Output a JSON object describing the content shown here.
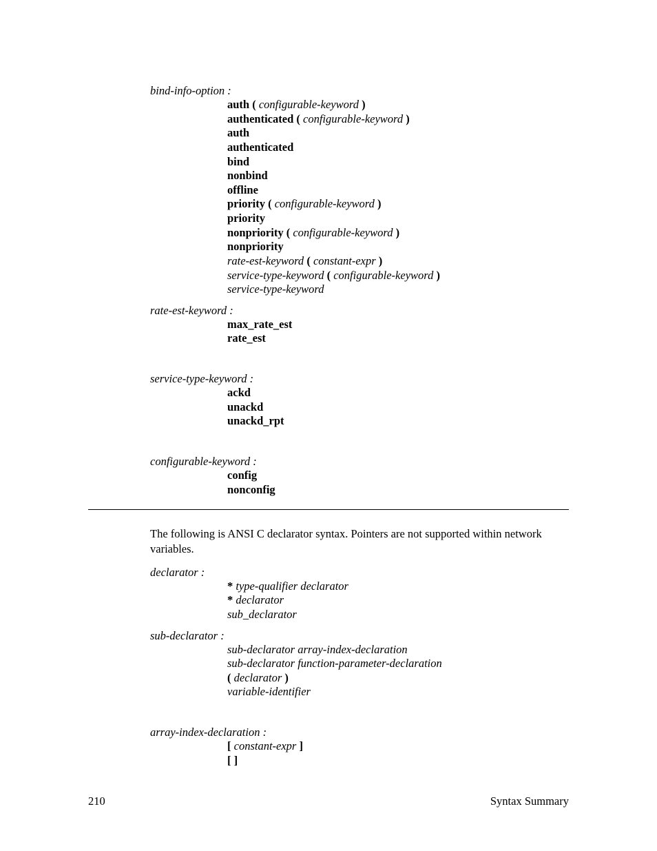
{
  "section1": {
    "head1": "bind-info-option :",
    "alts1": [
      [
        {
          "t": "kw",
          "v": "auth ("
        },
        {
          "t": "sp",
          "v": " "
        },
        {
          "t": "nt",
          "v": "configurable-keyword"
        },
        {
          "t": "sp",
          "v": " "
        },
        {
          "t": "kw",
          "v": ")"
        }
      ],
      [
        {
          "t": "kw",
          "v": "authenticated ("
        },
        {
          "t": "sp",
          "v": " "
        },
        {
          "t": "nt",
          "v": "configurable-keyword"
        },
        {
          "t": "sp",
          "v": " "
        },
        {
          "t": "kw",
          "v": ")"
        }
      ],
      [
        {
          "t": "kw",
          "v": "auth"
        }
      ],
      [
        {
          "t": "kw",
          "v": "authenticated"
        }
      ],
      [
        {
          "t": "kw",
          "v": "bind"
        }
      ],
      [
        {
          "t": "kw",
          "v": "nonbind"
        }
      ],
      [
        {
          "t": "kw",
          "v": "offline"
        }
      ],
      [
        {
          "t": "kw",
          "v": "priority ("
        },
        {
          "t": "sp",
          "v": " "
        },
        {
          "t": "nt",
          "v": "configurable-keyword"
        },
        {
          "t": "sp",
          "v": " "
        },
        {
          "t": "kw",
          "v": ")"
        }
      ],
      [
        {
          "t": "kw",
          "v": "priority"
        }
      ],
      [
        {
          "t": "kw",
          "v": "nonpriority ("
        },
        {
          "t": "sp",
          "v": " "
        },
        {
          "t": "nt",
          "v": "configurable-keyword"
        },
        {
          "t": "sp",
          "v": " "
        },
        {
          "t": "kw",
          "v": ")"
        }
      ],
      [
        {
          "t": "kw",
          "v": "nonpriority"
        }
      ],
      [
        {
          "t": "nt",
          "v": "rate-est-keyword"
        },
        {
          "t": "sp",
          "v": " "
        },
        {
          "t": "kw",
          "v": "("
        },
        {
          "t": "sp",
          "v": " "
        },
        {
          "t": "nt",
          "v": "constant-expr"
        },
        {
          "t": "sp",
          "v": " "
        },
        {
          "t": "kw",
          "v": ")"
        }
      ],
      [
        {
          "t": "nt",
          "v": "service-type-keyword"
        },
        {
          "t": "sp",
          "v": " "
        },
        {
          "t": "kw",
          "v": "("
        },
        {
          "t": "sp",
          "v": " "
        },
        {
          "t": "nt",
          "v": "configurable-keyword"
        },
        {
          "t": "sp",
          "v": " "
        },
        {
          "t": "kw",
          "v": ")"
        }
      ],
      [
        {
          "t": "nt",
          "v": "service-type-keyword"
        }
      ]
    ],
    "head2": "rate-est-keyword :",
    "alts2": [
      [
        {
          "t": "kw",
          "v": "max_rate_est"
        }
      ],
      [
        {
          "t": "kw",
          "v": "rate_est"
        }
      ]
    ],
    "head3": "service-type-keyword :",
    "alts3": [
      [
        {
          "t": "kw",
          "v": "ackd"
        }
      ],
      [
        {
          "t": "kw",
          "v": "unackd"
        }
      ],
      [
        {
          "t": "kw",
          "v": "unackd_rpt"
        }
      ]
    ],
    "head4": "configurable-keyword :",
    "alts4": [
      [
        {
          "t": "kw",
          "v": "config"
        }
      ],
      [
        {
          "t": "kw",
          "v": "nonconfig"
        }
      ]
    ]
  },
  "para": "The following is ANSI C declarator syntax.  Pointers are not supported within network variables.",
  "section2": {
    "head1": "declarator :",
    "alts1": [
      [
        {
          "t": "kw",
          "v": "*"
        },
        {
          "t": "sp",
          "v": " "
        },
        {
          "t": "nt",
          "v": "type-qualifier"
        },
        {
          "t": "sp",
          "v": "  "
        },
        {
          "t": "nt",
          "v": "declarator"
        }
      ],
      [
        {
          "t": "kw",
          "v": "*"
        },
        {
          "t": "sp",
          "v": " "
        },
        {
          "t": "nt",
          "v": "declarator"
        }
      ],
      [
        {
          "t": "nt",
          "v": "sub_declarator"
        }
      ]
    ],
    "head2": "sub-declarator :",
    "alts2": [
      [
        {
          "t": "nt",
          "v": "sub-declarator"
        },
        {
          "t": "sp",
          "v": "  "
        },
        {
          "t": "nt",
          "v": "array-index-declaration"
        }
      ],
      [
        {
          "t": "nt",
          "v": "sub-declarator"
        },
        {
          "t": "sp",
          "v": "  "
        },
        {
          "t": "nt",
          "v": "function-parameter-declaration"
        }
      ],
      [
        {
          "t": "kw",
          "v": "("
        },
        {
          "t": "sp",
          "v": " "
        },
        {
          "t": "nt",
          "v": "declarator"
        },
        {
          "t": "sp",
          "v": " "
        },
        {
          "t": "kw",
          "v": ")"
        }
      ],
      [
        {
          "t": "nt",
          "v": "variable-identifier"
        }
      ]
    ],
    "head3": "array-index-declaration :",
    "alts3": [
      [
        {
          "t": "kw",
          "v": "["
        },
        {
          "t": "sp",
          "v": " "
        },
        {
          "t": "nt",
          "v": "constant-expr"
        },
        {
          "t": "sp",
          "v": " "
        },
        {
          "t": "kw",
          "v": "]"
        }
      ],
      [
        {
          "t": "kw",
          "v": "[ ]"
        }
      ]
    ]
  },
  "footer": {
    "page": "210",
    "title": "Syntax Summary"
  }
}
